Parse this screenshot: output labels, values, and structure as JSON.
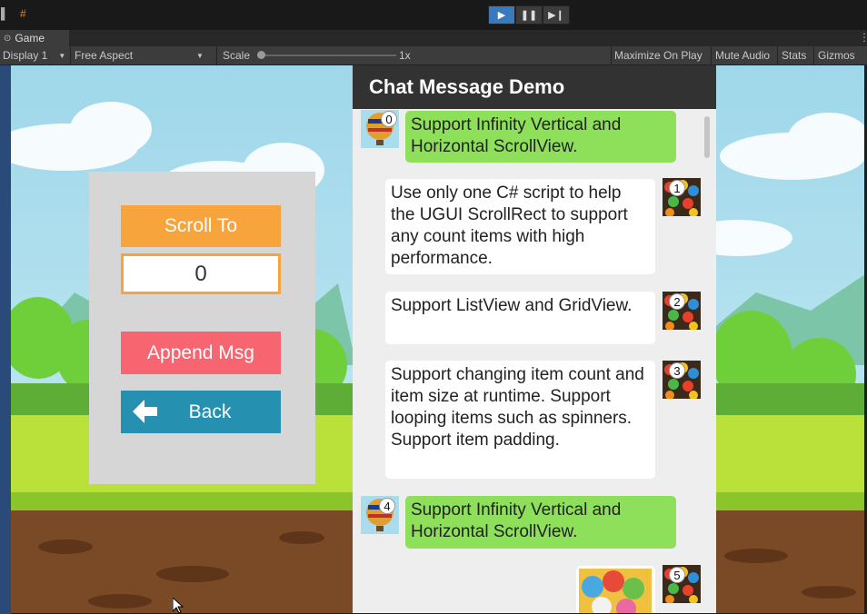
{
  "editor": {
    "tab_label": "Game",
    "display_label": "Display 1",
    "aspect_label": "Free Aspect",
    "scale_label": "Scale",
    "scale_value": "1x",
    "maximize_label": "Maximize On Play",
    "mute_label": "Mute Audio",
    "stats_label": "Stats",
    "gizmos_label": "Gizmos"
  },
  "controls": {
    "scroll_to_label": "Scroll To",
    "index_value": "0",
    "append_label": "Append Msg",
    "back_label": "Back"
  },
  "chat": {
    "title": "Chat Message Demo",
    "messages": [
      {
        "index": "0",
        "text": "Support Infinity Vertical and Horizontal ScrollView."
      },
      {
        "index": "1",
        "text": "Use only one C# script to help the UGUI ScrollRect to support any count items with high performance."
      },
      {
        "index": "2",
        "text": "Support ListView and GridView."
      },
      {
        "index": "3",
        "text": "Support changing item count and item size at runtime. Support looping items such as spinners. Support item padding."
      },
      {
        "index": "4",
        "text": "Support Infinity Vertical and Horizontal ScrollView."
      },
      {
        "index": "5",
        "text": ""
      }
    ]
  },
  "colors": {
    "scroll_to": "#f7a43c",
    "append": "#f76670",
    "back": "#2690b0",
    "bubble_green": "#8ee05a",
    "header": "#323232"
  },
  "icons": {
    "play": "play-icon",
    "pause": "pause-icon",
    "step": "step-icon",
    "back_arrow": "arrow-left-icon"
  }
}
